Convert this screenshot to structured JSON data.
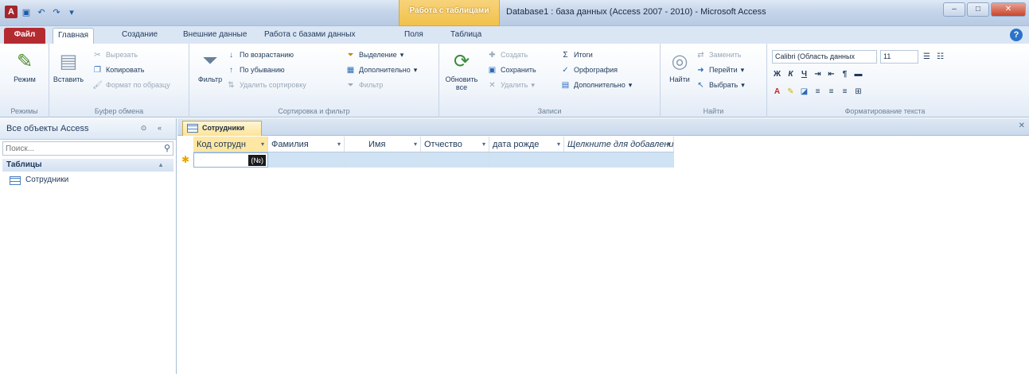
{
  "titlebar": {
    "contextual_tab": "Работа с таблицами",
    "window_title": "Database1 : база данных (Access 2007 - 2010) - Microsoft Access",
    "app_icon": "A",
    "controls": {
      "minimize": "–",
      "maximize": "□",
      "close": "✕"
    }
  },
  "ribbon_tabs": {
    "file": "Файл",
    "home": "Главная",
    "create": "Создание",
    "external": "Внешние данные",
    "dbtools": "Работа с базами данных",
    "fields": "Поля",
    "table": "Таблица"
  },
  "groups": {
    "views": {
      "label": "Режимы",
      "mode": "Режим"
    },
    "clipboard": {
      "label": "Буфер обмена",
      "paste": "Вставить",
      "cut": "Вырезать",
      "copy": "Копировать",
      "format_painter": "Формат по образцу"
    },
    "sort_filter": {
      "label": "Сортировка и фильтр",
      "filter": "Фильтр",
      "ascending": "По возрастанию",
      "descending": "По убыванию",
      "remove_sort": "Удалить сортировку",
      "selection": "Выделение",
      "advanced": "Дополнительно",
      "toggle_filter": "Фильтр"
    },
    "records": {
      "label": "Записи",
      "refresh": "Обновить все",
      "new": "Создать",
      "save": "Сохранить",
      "delete": "Удалить",
      "totals": "Итоги",
      "spelling": "Орфография",
      "more": "Дополнительно"
    },
    "find": {
      "label": "Найти",
      "find": "Найти",
      "replace": "Заменить",
      "goto": "Перейти",
      "select": "Выбрать"
    },
    "text_format": {
      "label": "Форматирование текста",
      "font": "Calibri (Область данных",
      "size": "11"
    }
  },
  "nav": {
    "title": "Все объекты Access",
    "search_placeholder": "Поиск...",
    "group": "Таблицы",
    "items": [
      "Сотрудники"
    ]
  },
  "document": {
    "tab": "Сотрудники",
    "columns": [
      "Код сотрудн",
      "Фамилия",
      "Имя",
      "Отчество",
      "дата рожде",
      "Щелкните для добавления"
    ],
    "new_badge": "(№)",
    "new_row_marker": "✱"
  }
}
